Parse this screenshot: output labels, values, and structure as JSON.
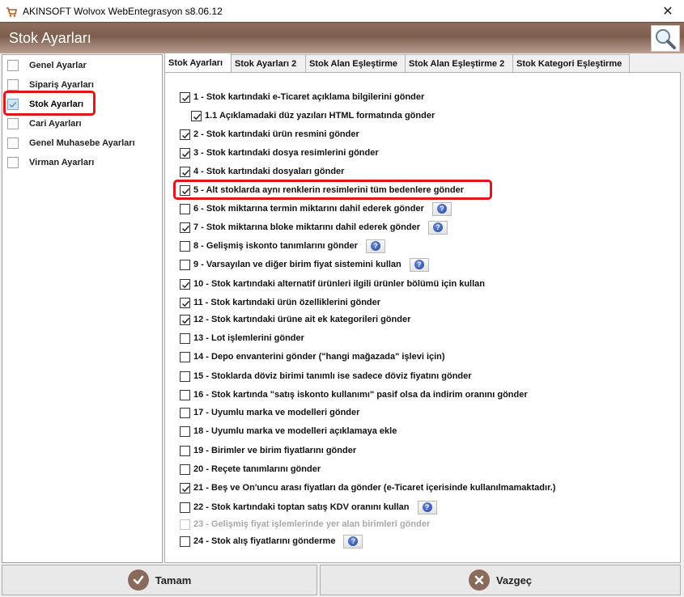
{
  "window": {
    "title": "AKINSOFT Wolvox WebEntegrasyon s8.06.12",
    "close_glyph": "✕"
  },
  "header": {
    "title": "Stok Ayarları",
    "search_icon": "search-icon"
  },
  "sidebar": {
    "items": [
      {
        "label": "Genel Ayarlar",
        "checked": false,
        "selected": false
      },
      {
        "label": "Sipariş Ayarları",
        "checked": false,
        "selected": false
      },
      {
        "label": "Stok Ayarları",
        "checked": true,
        "selected": true
      },
      {
        "label": "Cari Ayarları",
        "checked": false,
        "selected": false
      },
      {
        "label": "Genel Muhasebe Ayarları",
        "checked": false,
        "selected": false
      },
      {
        "label": "Virman Ayarları",
        "checked": false,
        "selected": false
      }
    ]
  },
  "tabs": [
    {
      "label": "Stok Ayarları",
      "active": true
    },
    {
      "label": "Stok Ayarları 2",
      "active": false
    },
    {
      "label": "Stok Alan Eşleştirme",
      "active": false
    },
    {
      "label": "Stok Alan Eşleştirme 2",
      "active": false
    },
    {
      "label": "Stok Kategori Eşleştirme",
      "active": false
    }
  ],
  "options": [
    {
      "label": "1 - Stok kartındaki e-Ticaret açıklama bilgilerini gönder",
      "checked": true,
      "help": false,
      "disabled": false
    },
    {
      "label": "1.1 Açıklamadaki düz yazıları HTML formatında gönder",
      "checked": true,
      "help": false,
      "disabled": false
    },
    {
      "label": "2 - Stok kartındaki ürün resmini gönder",
      "checked": true,
      "help": false,
      "disabled": false
    },
    {
      "label": "3 - Stok kartındaki dosya resimlerini gönder",
      "checked": true,
      "help": false,
      "disabled": false
    },
    {
      "label": "4 - Stok kartındaki dosyaları gönder",
      "checked": true,
      "help": false,
      "disabled": false
    },
    {
      "label": "5 - Alt stoklarda aynı renklerin resimlerini tüm bedenlere gönder",
      "checked": true,
      "help": false,
      "disabled": false
    },
    {
      "label": "6 - Stok miktarına termin miktarını dahil ederek gönder",
      "checked": false,
      "help": true,
      "disabled": false
    },
    {
      "label": "7 - Stok miktarına bloke miktarını dahil ederek gönder",
      "checked": true,
      "help": true,
      "disabled": false
    },
    {
      "label": "8 - Gelişmiş iskonto tanımlarını gönder",
      "checked": false,
      "help": true,
      "disabled": false
    },
    {
      "label": "9 - Varsayılan ve diğer birim fiyat sistemini kullan",
      "checked": false,
      "help": true,
      "disabled": false
    },
    {
      "label": "10 - Stok kartındaki alternatif ürünleri ilgili ürünler bölümü için kullan",
      "checked": true,
      "help": false,
      "disabled": false
    },
    {
      "label": "11 - Stok kartındaki ürün özelliklerini gönder",
      "checked": true,
      "help": false,
      "disabled": false
    },
    {
      "label": "12 - Stok kartındaki ürüne ait ek kategorileri gönder",
      "checked": true,
      "help": false,
      "disabled": false
    },
    {
      "label": "13 - Lot işlemlerini gönder",
      "checked": false,
      "help": false,
      "disabled": false
    },
    {
      "label": "14 - Depo envanterini gönder (\"hangi mağazada\" işlevi için)",
      "checked": false,
      "help": false,
      "disabled": false
    },
    {
      "label": "15 - Stoklarda döviz birimi tanımlı ise sadece döviz fiyatını gönder",
      "checked": false,
      "help": false,
      "disabled": false
    },
    {
      "label": "16 - Stok kartında \"satış iskonto kullanımı\" pasif olsa da indirim oranını gönder",
      "checked": false,
      "help": false,
      "disabled": false
    },
    {
      "label": "17 - Uyumlu marka ve modelleri gönder",
      "checked": false,
      "help": false,
      "disabled": false
    },
    {
      "label": "18 - Uyumlu marka ve modelleri açıklamaya ekle",
      "checked": false,
      "help": false,
      "disabled": false
    },
    {
      "label": "19 - Birimler ve birim fiyatlarını gönder",
      "checked": false,
      "help": false,
      "disabled": false
    },
    {
      "label": "20 - Reçete tanımlarını gönder",
      "checked": false,
      "help": false,
      "disabled": false
    },
    {
      "label": "21 - Beş ve On'uncu arası fiyatları da gönder (e-Ticaret içerisinde kullanılmamaktadır.)",
      "checked": true,
      "help": false,
      "disabled": false
    },
    {
      "label": "22 - Stok kartındaki toptan satış KDV oranını kullan",
      "checked": false,
      "help": true,
      "disabled": false
    },
    {
      "label": "23 - Gelişmiş fiyat işlemlerinde yer alan birimleri gönder",
      "checked": false,
      "help": false,
      "disabled": true
    },
    {
      "label": "24 - Stok alış fiyatlarını gönderme",
      "checked": false,
      "help": true,
      "disabled": false
    }
  ],
  "help_glyph": "?",
  "buttons": {
    "ok_label": "Tamam",
    "cancel_label": "Vazgeç"
  }
}
